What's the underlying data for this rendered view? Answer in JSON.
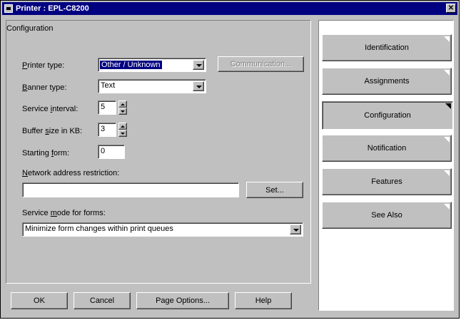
{
  "window": {
    "title": "Printer : EPL-C8200"
  },
  "config": {
    "group_title": "Configuration",
    "printer_type": {
      "label_u": "P",
      "label_rest": "rinter type:",
      "value": "Other / Unknown"
    },
    "communication_label": "Communication...",
    "banner_type": {
      "label_u": "B",
      "label_rest": "anner type:",
      "value": "Text"
    },
    "service_interval": {
      "label_a": "Service ",
      "label_u": "i",
      "label_b": "nterval:",
      "value": "5"
    },
    "buffer_size": {
      "label_a": "Buffer ",
      "label_u": "s",
      "label_b": "ize in KB:",
      "value": "3"
    },
    "starting_form": {
      "label_a": "Starting ",
      "label_u": "f",
      "label_b": "orm:",
      "value": "0"
    },
    "network_restriction": {
      "label_u": "N",
      "label_rest": "etwork address restriction:",
      "value": ""
    },
    "set_label": "Set...",
    "service_mode": {
      "label_a": "Service ",
      "label_u": "m",
      "label_b": "ode for forms:",
      "value": "Minimize form changes within print queues"
    }
  },
  "footer": {
    "ok": "OK",
    "cancel": "Cancel",
    "page_options": "Page Options...",
    "help": "Help"
  },
  "nav": [
    {
      "label": "Identification",
      "active": false
    },
    {
      "label": "Assignments",
      "active": false
    },
    {
      "label": "Configuration",
      "active": true
    },
    {
      "label": "Notification",
      "active": false
    },
    {
      "label": "Features",
      "active": false
    },
    {
      "label": "See Also",
      "active": false
    }
  ]
}
